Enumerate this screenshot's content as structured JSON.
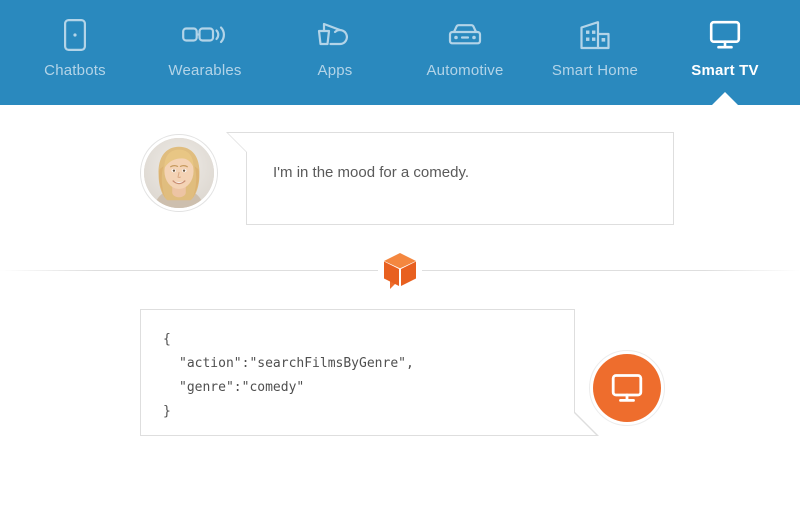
{
  "tabs": [
    {
      "id": "chatbots",
      "label": "Chatbots",
      "icon": "phone-chat-icon",
      "active": false
    },
    {
      "id": "wearables",
      "label": "Wearables",
      "icon": "glasses-icon",
      "active": false
    },
    {
      "id": "apps",
      "label": "Apps",
      "icon": "apps-icon",
      "active": false
    },
    {
      "id": "automotive",
      "label": "Automotive",
      "icon": "car-icon",
      "active": false
    },
    {
      "id": "smart-home",
      "label": "Smart Home",
      "icon": "building-icon",
      "active": false
    },
    {
      "id": "smart-tv",
      "label": "Smart TV",
      "icon": "monitor-icon",
      "active": true
    }
  ],
  "conversation": {
    "user_message": {
      "avatar": "woman-avatar-photo",
      "text": "I'm in the mood for a comedy."
    },
    "divider_logo": "orange-box-logo",
    "bot_response": {
      "code_lines": [
        "{",
        "\"action\":\"searchFilmsByGenre\",",
        "\"genre\":\"comedy\"",
        "}"
      ],
      "badge_icon": "monitor-icon"
    }
  },
  "colors": {
    "header_blue": "#2a89be",
    "accent_orange": "#ee6d2d",
    "tab_inactive_text": "#b3d4e8",
    "tab_active_text": "#ffffff",
    "bubble_border": "#dedede",
    "text": "#5a5a5a"
  }
}
